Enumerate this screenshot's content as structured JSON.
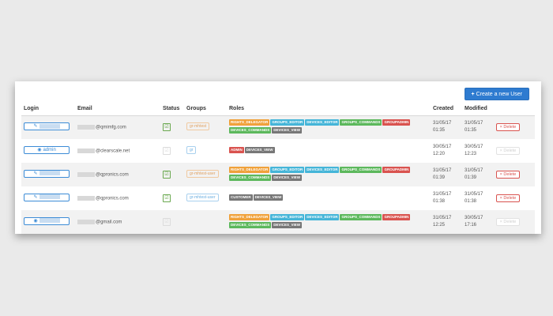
{
  "toolbar": {
    "create_label": "Create a new User",
    "create_icon": "plus-icon"
  },
  "table": {
    "headers": {
      "login": "Login",
      "email": "Email",
      "status": "Status",
      "groups": "Groups",
      "roles": "Roles",
      "created": "Created",
      "modified": "Modified"
    },
    "rows": [
      {
        "login_icon": "pencil-icon",
        "login_label": "",
        "email_suffix": "@qmimfg.com",
        "status_checked": true,
        "group": "gr-mhtest",
        "roles": [
          {
            "label": "RIGHTS_DELEGATOR",
            "color": "#f0a13a"
          },
          {
            "label": "GROUPS_EDITOR",
            "color": "#45b5d8"
          },
          {
            "label": "DEVICES_EDITOR",
            "color": "#45b5d8"
          },
          {
            "label": "GROUPS_COMMANDS",
            "color": "#5cb85c"
          },
          {
            "label": "GROUPADMIN",
            "color": "#d9534f"
          },
          {
            "label": "DEVICES_COMMANDS",
            "color": "#5cb85c"
          },
          {
            "label": "DEVICES_VIEW",
            "color": "#777777"
          }
        ],
        "created_date": "31/05/17",
        "created_time": "01:35",
        "modified_date": "31/05/17",
        "modified_time": "01:35",
        "delete_label": "Delete",
        "delete_enabled": true
      },
      {
        "login_icon": "eye-icon",
        "login_label": "admin",
        "email_suffix": "@clearscale.net",
        "status_checked": false,
        "group": "gr",
        "roles": [
          {
            "label": "ADMIN",
            "color": "#d9534f"
          },
          {
            "label": "DEVICES_VIEW",
            "color": "#777777"
          }
        ],
        "created_date": "30/05/17",
        "created_time": "12:20",
        "modified_date": "30/05/17",
        "modified_time": "12:23",
        "delete_label": "Delete",
        "delete_enabled": false
      },
      {
        "login_icon": "pencil-icon",
        "login_label": "",
        "email_suffix": "@qpronics.com",
        "status_checked": true,
        "group": "gr-mhtest-user",
        "roles": [
          {
            "label": "RIGHTS_DELEGATOR",
            "color": "#f0a13a"
          },
          {
            "label": "GROUPS_EDITOR",
            "color": "#45b5d8"
          },
          {
            "label": "DEVICES_EDITOR",
            "color": "#45b5d8"
          },
          {
            "label": "GROUPS_COMMANDS",
            "color": "#5cb85c"
          },
          {
            "label": "GROUPADMIN",
            "color": "#d9534f"
          },
          {
            "label": "DEVICES_COMMANDS",
            "color": "#5cb85c"
          },
          {
            "label": "DEVICES_VIEW",
            "color": "#777777"
          }
        ],
        "created_date": "31/05/17",
        "created_time": "01:39",
        "modified_date": "31/05/17",
        "modified_time": "01:39",
        "delete_label": "Delete",
        "delete_enabled": true
      },
      {
        "login_icon": "pencil-icon",
        "login_label": "",
        "email_suffix": "@qpronics.com",
        "status_checked": true,
        "group": "gr-mhtest-user",
        "roles": [
          {
            "label": "CUSTOMER",
            "color": "#777777"
          },
          {
            "label": "DEVICES_VIEW",
            "color": "#777777"
          }
        ],
        "created_date": "31/05/17",
        "created_time": "01:38",
        "modified_date": "31/05/17",
        "modified_time": "01:38",
        "delete_label": "Delete",
        "delete_enabled": true
      },
      {
        "login_icon": "eye-icon",
        "login_label": "",
        "email_suffix": "@gmail.com",
        "status_checked": false,
        "group": "",
        "roles": [
          {
            "label": "RIGHTS_DELEGATOR",
            "color": "#f0a13a"
          },
          {
            "label": "GROUPS_EDITOR",
            "color": "#45b5d8"
          },
          {
            "label": "DEVICES_EDITOR",
            "color": "#45b5d8"
          },
          {
            "label": "GROUPS_COMMANDS",
            "color": "#5cb85c"
          },
          {
            "label": "GROUPADMIN",
            "color": "#d9534f"
          },
          {
            "label": "DEVICES_COMMANDS",
            "color": "#5cb85c"
          },
          {
            "label": "DEVICES_VIEW",
            "color": "#777777"
          }
        ],
        "created_date": "31/05/17",
        "created_time": "12:25",
        "modified_date": "30/05/17",
        "modified_time": "17:16",
        "delete_label": "Delete",
        "delete_enabled": false
      }
    ]
  }
}
